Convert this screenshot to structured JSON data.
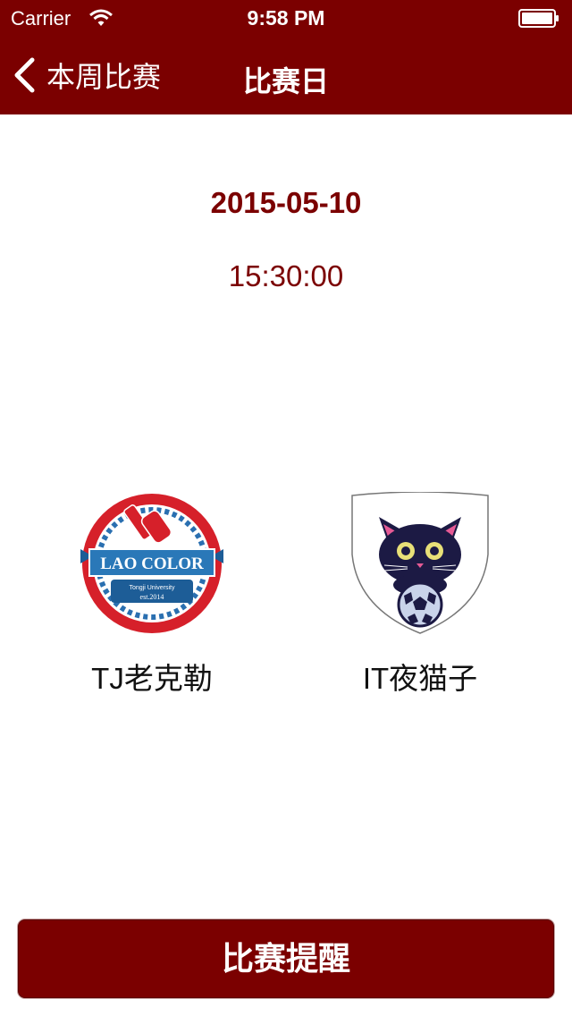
{
  "status_bar": {
    "carrier": "Carrier",
    "time": "9:58 PM",
    "icons": [
      "wifi-icon",
      "battery-icon"
    ]
  },
  "nav_bar": {
    "back_label": "本周比赛",
    "title": "比赛日",
    "back_icon": "chevron-left-icon"
  },
  "match": {
    "date": "2015-05-10",
    "time": "15:30:00",
    "home_team": {
      "name": "TJ老克勒",
      "logo": {
        "banner_text": "LAO COLOR",
        "subtitle": "Tongji University",
        "est": "est.2014"
      }
    },
    "away_team": {
      "name": "IT夜猫子",
      "logo": "cat-with-ball-shield"
    }
  },
  "remind_button": {
    "label": "比赛提醒"
  },
  "colors": {
    "accent": "#7b0000",
    "background": "#ffffff"
  }
}
